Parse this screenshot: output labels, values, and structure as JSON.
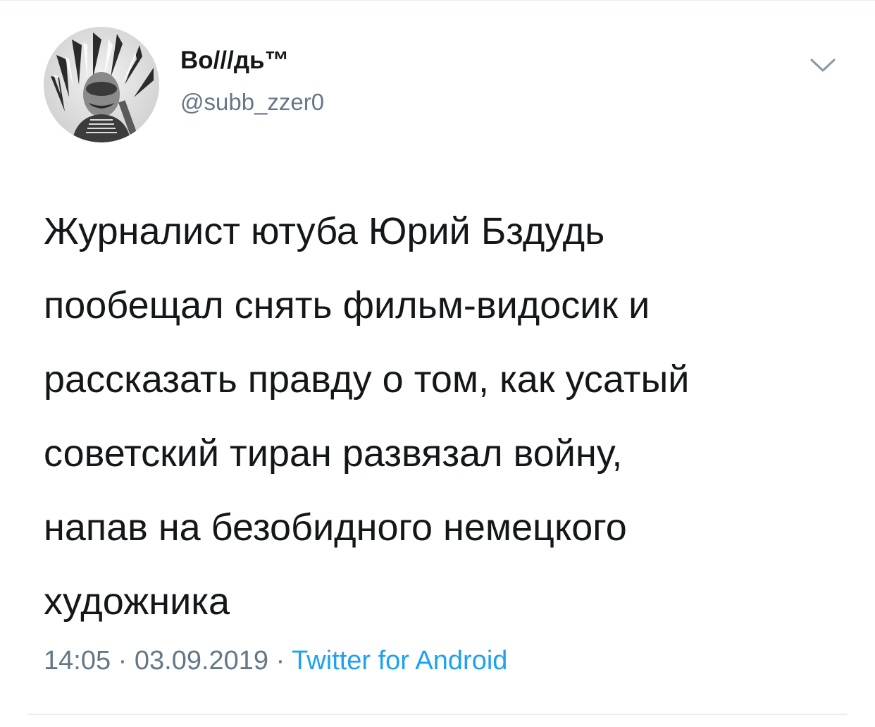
{
  "tweet": {
    "author": {
      "display_name": "Во///дь™",
      "handle": "@subb_zzer0"
    },
    "text_lines": [
      "Журналист ютуба Юрий Бздудь",
      "пообещал снять фильм-видосик и",
      "рассказать правду о том, как усатый",
      "советский тиран развязал войну,",
      "напав на безобидного немецкого",
      "художника"
    ],
    "time": "14:05",
    "date": "03.09.2019",
    "separator": "·",
    "source": "Twitter for Android"
  },
  "icons": {
    "menu": "chevron-down-icon",
    "avatar": "avatar-image"
  },
  "colors": {
    "text": "#14171a",
    "secondary": "#657786",
    "link": "#1da1f2",
    "divider": "#e6ecf0"
  }
}
